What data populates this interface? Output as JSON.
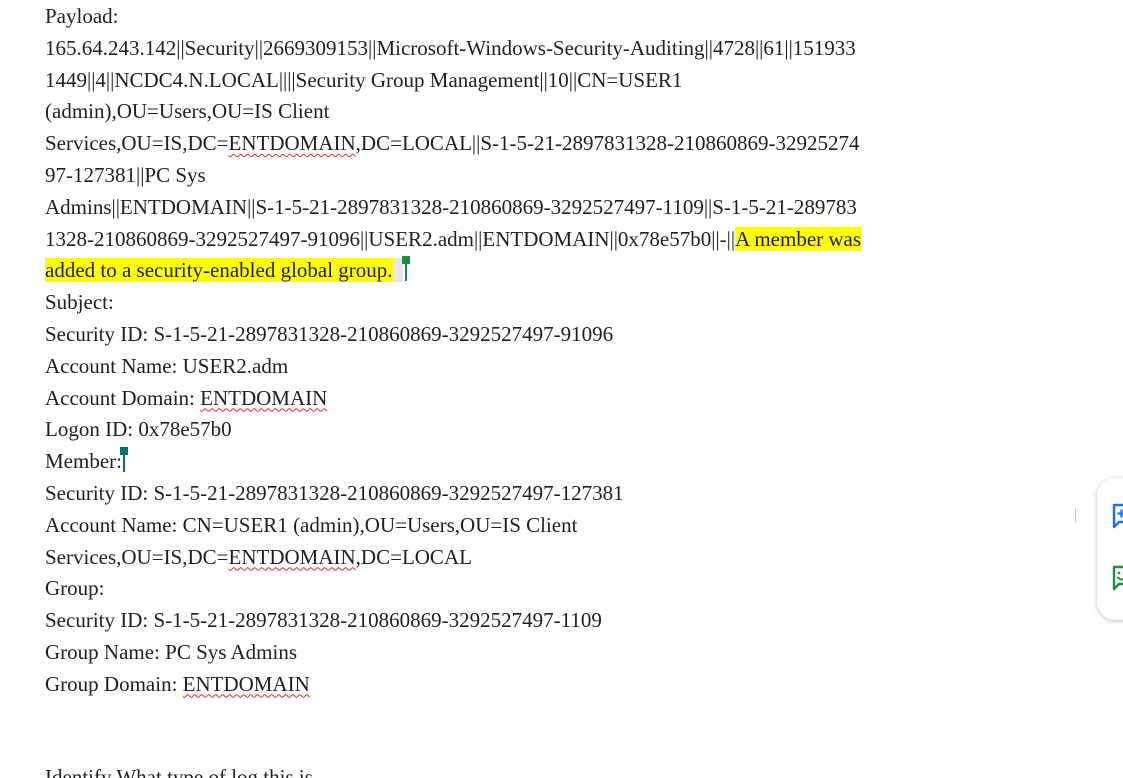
{
  "document": {
    "lines": [
      "Payload:",
      "165.64.243.142||Security||2669309153||Microsoft-Windows-Security-Auditing||4728||61||151933",
      "1449||4||NCDC4.N.LOCAL||||Security Group Management||10||CN=USER1",
      "(admin),OU=Users,OU=IS Client",
      {
        "before": "Services,OU=IS,DC=",
        "flagged": "ENTDOMAIN",
        "after": ",DC=LOCAL||S-1-5-21-2897831328-210860869-32925274"
      },
      "97-127381||PC Sys",
      "Admins||ENTDOMAIN||S-1-5-21-2897831328-210860869-3292527497-1109||S-1-5-21-289783",
      {
        "before": "1328-210860869-3292527497-91096||USER2.adm||ENTDOMAIN||0x78e57b0||-||",
        "highlighted": "A member was"
      },
      {
        "highlighted": "added to a security-enabled global group."
      },
      "Subject:",
      "Security ID: S-1-5-21-2897831328-210860869-3292527497-91096",
      "Account Name: USER2.adm",
      {
        "before": "Account Domain: ",
        "flagged": "ENTDOMAIN",
        "after": ""
      },
      "Logon ID: 0x78e57b0",
      "Member:",
      "Security ID: S-1-5-21-2897831328-210860869-3292527497-127381",
      "Account Name: CN=USER1 (admin),OU=Users,OU=IS Client",
      {
        "before": "Services,OU=IS,DC=",
        "flagged": "ENTDOMAIN",
        "after": ",DC=LOCAL"
      },
      "Group:",
      "Security ID: S-1-5-21-2897831328-210860869-3292527497-1109",
      "Group Name: PC Sys Admins",
      {
        "before": "Group Domain: ",
        "flagged": "ENTDOMAIN",
        "after": ""
      }
    ],
    "cutoff_line": "Identify What type of log this is"
  },
  "side_panel": {
    "buttons": [
      {
        "icon": "add-comment-icon",
        "color": "#1a73e8"
      },
      {
        "icon": "emoji-reaction-icon",
        "color": "#1e8e3e"
      }
    ]
  },
  "colors": {
    "highlight": "#ffff00",
    "spellcheck": "#d93025",
    "cursor_a": "#1e8e3e",
    "cursor_b": "#0b6e6e"
  }
}
